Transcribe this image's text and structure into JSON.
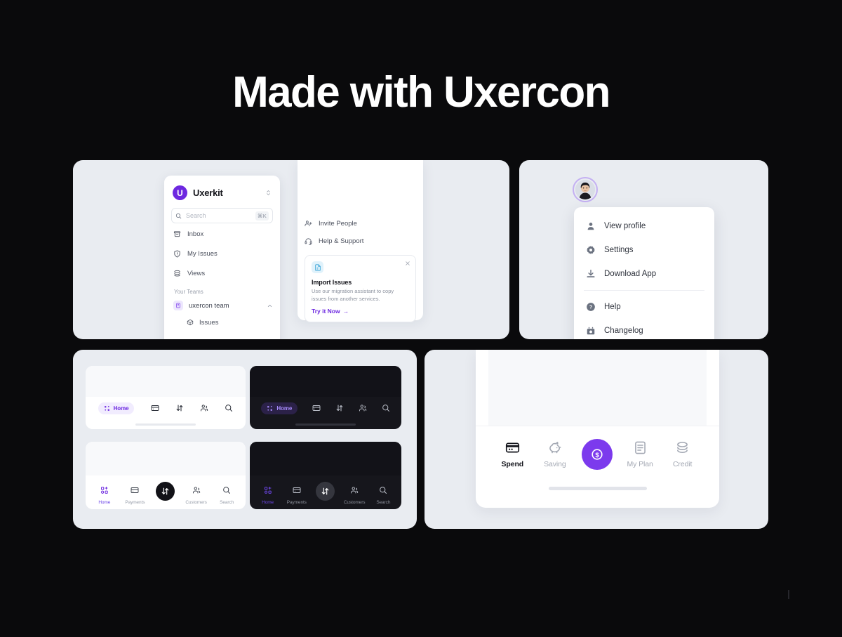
{
  "hero": {
    "title": "Made with Uxercon"
  },
  "sidebar_card": {
    "app": {
      "logo_letter": "U",
      "name": "Uxerkit",
      "switcher_icon": "chevron-updown-icon"
    },
    "search": {
      "placeholder": "Search",
      "shortcut": "⌘K",
      "icon": "search-icon"
    },
    "nav": [
      {
        "label": "Inbox",
        "icon": "inbox-icon"
      },
      {
        "label": "My Issues",
        "icon": "shield-alert-icon"
      },
      {
        "label": "Views",
        "icon": "layers-icon"
      }
    ],
    "section_label": "Your Teams",
    "team": {
      "label": "uxercon team",
      "icon": "team-badge-icon",
      "caret": "chevron-up-icon"
    },
    "team_children": [
      {
        "label": "Issues",
        "icon": "box-icon"
      }
    ],
    "secondary": [
      {
        "label": "Invite People",
        "icon": "user-plus-icon"
      },
      {
        "label": "Help & Support",
        "icon": "headset-icon"
      }
    ],
    "promo": {
      "icon": "document-import-icon",
      "close_icon": "close-icon",
      "title": "Import Issues",
      "body": "Use our migration assistant to copy issues from another services.",
      "cta": "Try it Now",
      "cta_arrow": "→"
    },
    "colors": {
      "brand": "#6d28e0",
      "promo_icon_bg": "#e0f2fb"
    }
  },
  "profile_card": {
    "avatar": {
      "name": "avatar",
      "ring_color": "#c4b0f2"
    },
    "menu": [
      {
        "label": "View profile",
        "icon": "user-icon"
      },
      {
        "label": "Settings",
        "icon": "gear-icon"
      },
      {
        "label": "Download App",
        "icon": "download-icon"
      },
      {
        "label": "Help",
        "icon": "help-circle-icon"
      },
      {
        "label": "Changelog",
        "icon": "changelog-icon"
      }
    ],
    "divider_after_index": 2
  },
  "navbars_card": {
    "variants": [
      {
        "id": "compact-light",
        "theme": "light",
        "active_label": "Home",
        "icons": [
          "grid-dots-icon",
          "card-icon",
          "transfer-icon",
          "customers-icon",
          "search-icon"
        ]
      },
      {
        "id": "compact-dark",
        "theme": "dark",
        "active_label": "Home",
        "icons": [
          "grid-dots-icon",
          "card-icon",
          "transfer-icon",
          "customers-icon",
          "search-icon"
        ]
      },
      {
        "id": "labeled-light",
        "theme": "light",
        "items": [
          {
            "label": "Home",
            "icon": "grid-plus-icon",
            "active": true
          },
          {
            "label": "Payments",
            "icon": "card-icon",
            "active": false
          },
          {
            "label": "",
            "icon": "transfer-icon",
            "fab": true
          },
          {
            "label": "Customers",
            "icon": "customers-icon",
            "active": false
          },
          {
            "label": "Search",
            "icon": "search-icon",
            "active": false
          }
        ]
      },
      {
        "id": "labeled-dark",
        "theme": "dark",
        "items": [
          {
            "label": "Home",
            "icon": "grid-plus-icon",
            "active": true
          },
          {
            "label": "Payments",
            "icon": "card-icon",
            "active": false
          },
          {
            "label": "",
            "icon": "transfer-icon",
            "fab": true
          },
          {
            "label": "Customers",
            "icon": "customers-icon",
            "active": false
          },
          {
            "label": "Search",
            "icon": "search-icon",
            "active": false
          }
        ]
      }
    ],
    "colors": {
      "accent_light": "#6d28e0",
      "accent_dark": "#a78bfa",
      "dark_bg": "#16161c"
    }
  },
  "tabbar_card": {
    "items": [
      {
        "label": "Spend",
        "icon": "card-filled-icon",
        "active": true
      },
      {
        "label": "Saving",
        "icon": "piggy-bank-icon",
        "active": false
      },
      {
        "label": "",
        "icon": "dollar-coin-icon",
        "fab": true
      },
      {
        "label": "My Plan",
        "icon": "document-icon",
        "active": false
      },
      {
        "label": "Credit",
        "icon": "coins-icon",
        "active": false
      }
    ],
    "colors": {
      "fab_bg": "#7c3aed",
      "active_text": "#12131a",
      "inactive_text": "#a3a8b3"
    }
  }
}
